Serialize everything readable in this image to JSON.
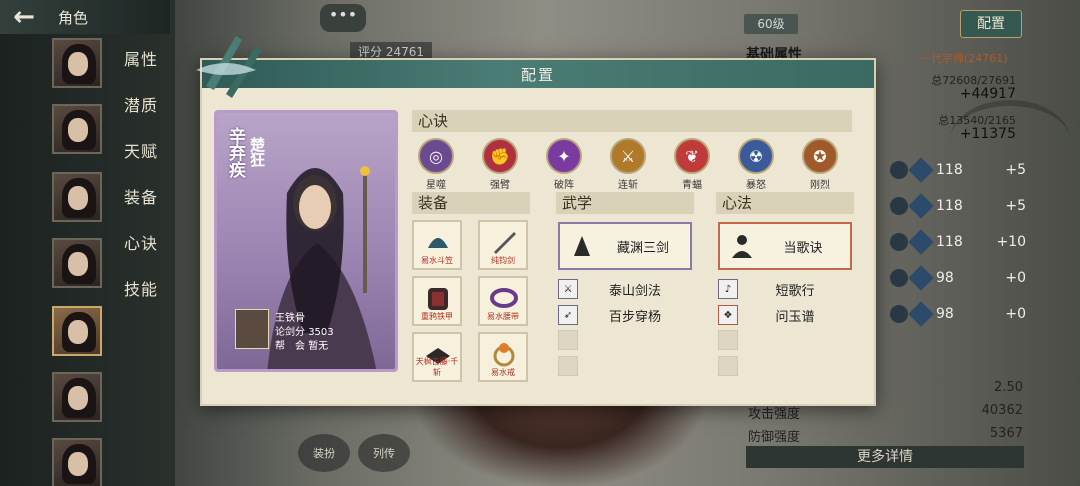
{
  "header": {
    "back_icon": "arrow-left-icon",
    "title": "角色",
    "chat_icon": "chat-bubble-icon",
    "chat_text": "•••",
    "score_label": "评分",
    "score_value": "24761"
  },
  "sidebar": {
    "items": [
      {
        "label": "属性"
      },
      {
        "label": "潜质"
      },
      {
        "label": "天赋"
      },
      {
        "label": "装备"
      },
      {
        "label": "心诀"
      },
      {
        "label": "技能"
      }
    ]
  },
  "right_panel": {
    "level": "60级",
    "config_button": "配置",
    "base_title": "基础属性",
    "sect_label": "一代宗师(24761)",
    "total1": "总72608/27691",
    "big1": "+44917",
    "total2": "总13540/2165",
    "big2": "+11375",
    "stats": [
      {
        "value": "118",
        "delta": "+5"
      },
      {
        "value": "118",
        "delta": "+5"
      },
      {
        "value": "118",
        "delta": "+10"
      },
      {
        "value": "98",
        "delta": "+0"
      },
      {
        "value": "98",
        "delta": "+0"
      }
    ],
    "lower": [
      {
        "label": "",
        "value": "2.50"
      },
      {
        "label": "攻击强度",
        "value": "40362"
      },
      {
        "label": "防御强度",
        "value": "5367"
      }
    ],
    "more_button": "更多详情"
  },
  "bottom_buttons": [
    {
      "label": "装扮"
    },
    {
      "label": "列传"
    }
  ],
  "modal": {
    "title": "配置",
    "card": {
      "name": "辛弃疾",
      "title": "楚狂",
      "user_name": "王铁骨",
      "sword_score_label": "论剑分",
      "sword_score": "3503",
      "guild_label": "帮　会",
      "guild_value": "暂无"
    },
    "xinjue_title": "心诀",
    "skills": [
      {
        "name": "星噬",
        "color": "#6a4a90",
        "icon": "swirl-icon"
      },
      {
        "name": "强臂",
        "color": "#b03040",
        "icon": "arm-icon"
      },
      {
        "name": "破阵",
        "color": "#7a3aa0",
        "icon": "shatter-icon"
      },
      {
        "name": "连斩",
        "color": "#b07a2a",
        "icon": "slash-icon"
      },
      {
        "name": "青蝠",
        "color": "#c03a3a",
        "icon": "bat-icon"
      },
      {
        "name": "暴怒",
        "color": "#3a5a9a",
        "icon": "rage-icon"
      },
      {
        "name": "刚烈",
        "color": "#a05a2a",
        "icon": "fist-icon"
      }
    ],
    "equip_title": "装备",
    "equipment": [
      {
        "label": "易水斗笠",
        "icon": "hat-icon"
      },
      {
        "label": "纯钧剑",
        "icon": "sword-icon"
      },
      {
        "label": "重鸦铁甲",
        "icon": "armor-icon"
      },
      {
        "label": "易水腰带",
        "icon": "belt-icon"
      },
      {
        "label": "天枫古藤·千斩",
        "icon": "book-icon"
      },
      {
        "label": "易水戒",
        "icon": "ring-icon"
      }
    ],
    "wuxue_title": "武学",
    "wuxue_main": "藏渊三剑",
    "wuxue_subs": [
      "泰山剑法",
      "百步穿杨"
    ],
    "xinfa_title": "心法",
    "xinfa_main": "当歌诀",
    "xinfa_subs": [
      "短歌行",
      "问玉谱"
    ]
  }
}
